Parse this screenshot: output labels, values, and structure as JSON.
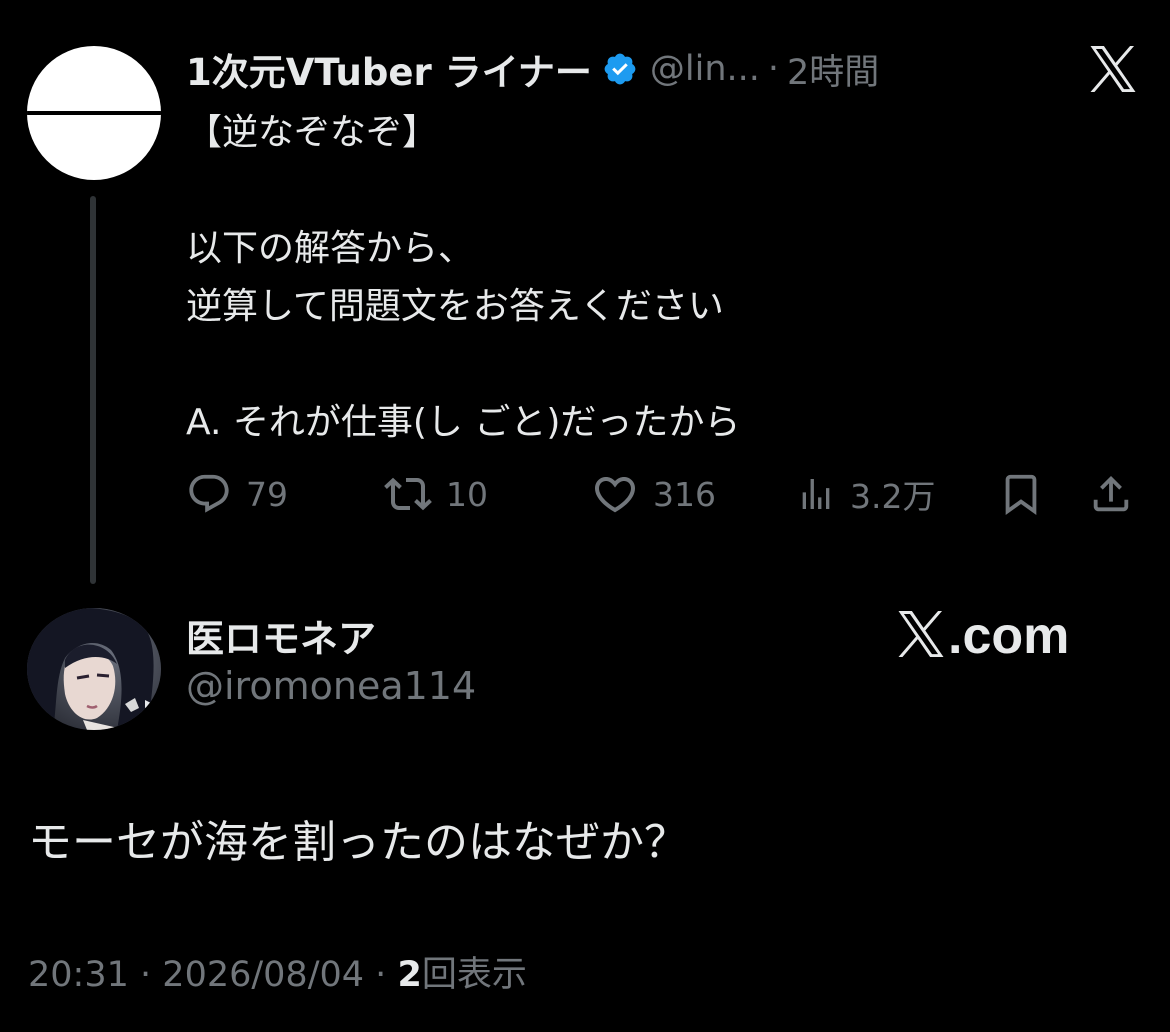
{
  "parent_tweet": {
    "author_name": "1次元VTuber ライナー",
    "handle": "@lin...",
    "separator": "·",
    "time_ago": "2時間",
    "text": "【逆なぞなぞ】\n\n以下の解答から、\n逆算して問題文をお答えください\n\nA. それが仕事(し ごと)だったから",
    "stats": {
      "replies": "79",
      "retweets": "10",
      "likes": "316",
      "views": "3.2万"
    }
  },
  "reply_tweet": {
    "author_name": "医ロモネア",
    "handle": "@iromonea114",
    "text": "モーセが海を割ったのはなぜか？",
    "timestamp": "20:31",
    "separator": "·",
    "date": "2026/08/04",
    "view_count": "2",
    "view_label": "回表示"
  },
  "brand": {
    "watermark_text": ".com"
  },
  "colors": {
    "background": "#000000",
    "text_primary": "#e7e9ea",
    "text_secondary": "#71767b",
    "verified_blue": "#1d9bf0",
    "thread_line": "#2f3336"
  },
  "icons": {
    "verified": "verified-badge-icon",
    "x_logo": "x-logo-icon",
    "reply": "speech-bubble-icon",
    "retweet": "retweet-arrows-icon",
    "like": "heart-icon",
    "views": "bar-chart-icon",
    "bookmark": "bookmark-icon",
    "share": "share-upload-icon"
  }
}
